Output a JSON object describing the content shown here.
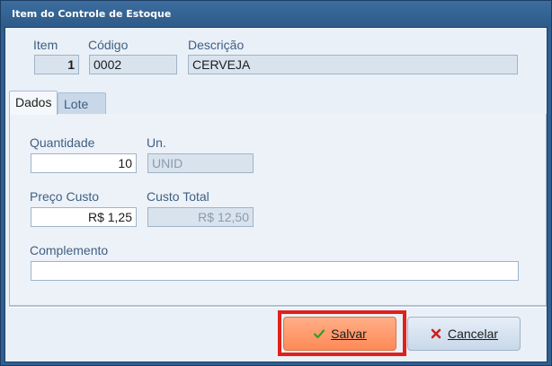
{
  "window": {
    "title": "Item do Controle de Estoque"
  },
  "header": {
    "item_label": "Item",
    "item_value": "1",
    "codigo_label": "Código",
    "codigo_value": "0002",
    "descricao_label": "Descrição",
    "descricao_value": "CERVEJA"
  },
  "tabs": [
    {
      "label": "Dados",
      "active": true
    },
    {
      "label": "Lote",
      "active": false
    }
  ],
  "dados": {
    "quantidade_label": "Quantidade",
    "quantidade_value": "10",
    "un_label": "Un.",
    "un_value": "UNID",
    "preco_custo_label": "Preço Custo",
    "preco_custo_value": "R$ 1,25",
    "custo_total_label": "Custo Total",
    "custo_total_value": "R$ 12,50",
    "complemento_label": "Complemento",
    "complemento_value": ""
  },
  "buttons": {
    "save_label": "Salvar",
    "cancel_label": "Cancelar"
  },
  "colors": {
    "save_button": "#ff8a57",
    "highlight_border": "#e0201b",
    "titlebar": "#2f5f8f"
  },
  "icons": {
    "save": "check-icon",
    "cancel": "x-icon"
  }
}
